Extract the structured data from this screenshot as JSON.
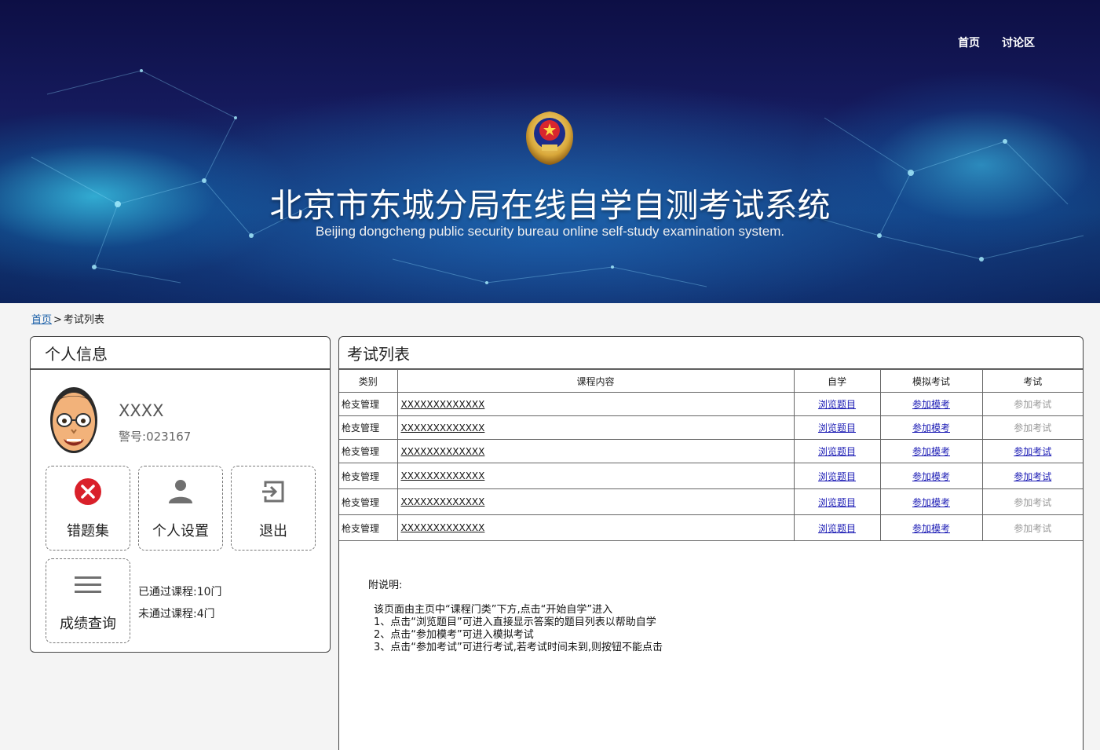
{
  "nav": {
    "home": "首页",
    "forum": "讨论区"
  },
  "banner": {
    "title_cn": "北京市东城分局在线自学自测考试系统",
    "title_en": "Beijing dongcheng public security bureau online self-study examination system."
  },
  "breadcrumb": {
    "home": "首页",
    "sep": ">",
    "current": "考试列表"
  },
  "profile": {
    "heading": "个人信息",
    "name": "XXXX",
    "badge_label": "警号:",
    "badge_number": "023167",
    "tiles": {
      "wrong_questions": "错题集",
      "settings": "个人设置",
      "logout": "退出",
      "scores": "成绩查询"
    },
    "stats": {
      "passed": "已通过课程:10门",
      "failed": "未通过课程:4门"
    }
  },
  "exam_list": {
    "heading": "考试列表",
    "columns": [
      "类别",
      "课程内容",
      "自学",
      "模拟考试",
      "考试"
    ],
    "rows": [
      {
        "category": "枪支管理",
        "content": "XXXXXXXXXXXXX",
        "study": "浏览题目",
        "mock": "参加模考",
        "exam": "参加考试",
        "exam_enabled": false
      },
      {
        "category": "枪支管理",
        "content": "XXXXXXXXXXXXX",
        "study": "浏览题目",
        "mock": "参加模考",
        "exam": "参加考试",
        "exam_enabled": false
      },
      {
        "category": "枪支管理",
        "content": "XXXXXXXXXXXXX",
        "study": "浏览题目",
        "mock": "参加模考",
        "exam": "参加考试",
        "exam_enabled": true
      },
      {
        "category": "枪支管理",
        "content": "XXXXXXXXXXXXX",
        "study": "浏览题目",
        "mock": "参加模考",
        "exam": "参加考试",
        "exam_enabled": true
      },
      {
        "category": "枪支管理",
        "content": "XXXXXXXXXXXXX",
        "study": "浏览题目",
        "mock": "参加模考",
        "exam": "参加考试",
        "exam_enabled": false
      },
      {
        "category": "枪支管理",
        "content": "XXXXXXXXXXXXX",
        "study": "浏览题目",
        "mock": "参加模考",
        "exam": "参加考试",
        "exam_enabled": false
      }
    ],
    "notes": {
      "title": "附说明:",
      "lines": [
        "该页面由主页中“课程门类”下方,点击“开始自学”进入",
        "1、点击“浏览题目”可进入直接显示答案的题目列表以帮助自学",
        "2、点击“参加模考”可进入模拟考试",
        "3、点击“参加考试”可进行考试,若考试时间未到,则按钮不能点击"
      ]
    }
  },
  "colors": {
    "link": "#1a1ab4",
    "disabled": "#999999",
    "error_red": "#d9202a",
    "banner_dark": "#0d0f45",
    "banner_cyan": "#3cd2f0"
  },
  "icons": [
    "police-emblem-icon",
    "avatar-icon",
    "close-circle-icon",
    "person-icon",
    "exit-icon",
    "menu-icon"
  ]
}
